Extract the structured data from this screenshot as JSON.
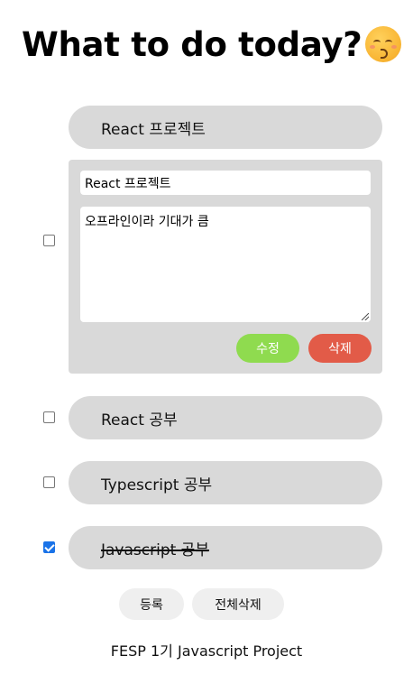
{
  "header": {
    "title": "What to do today?",
    "emoji": "kissing-face-icon"
  },
  "todos": [
    {
      "label": "React 프로젝트",
      "checked": false,
      "editing": true,
      "edit_title": "React 프로젝트",
      "edit_content": "오프라인이라 기대가 큼",
      "edit_button": "수정",
      "delete_button": "삭제"
    },
    {
      "label": "React 공부",
      "checked": false
    },
    {
      "label": "Typescript 공부",
      "checked": false
    },
    {
      "label": "Javascript 공부",
      "checked": true
    }
  ],
  "actions": {
    "register": "등록",
    "delete_all": "전체삭제"
  },
  "footer": {
    "text": "FESP 1기 Javascript Project"
  },
  "colors": {
    "pill": "#d9d9d9",
    "edit": "#8fdb4f",
    "delete": "#e25b48",
    "checkbox": "#1a73e8"
  }
}
